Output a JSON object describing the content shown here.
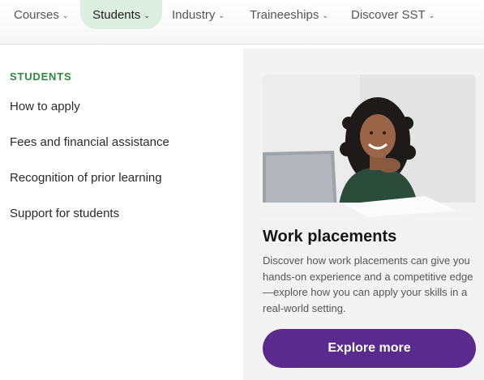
{
  "nav": {
    "items": [
      {
        "label": "Courses",
        "active": false
      },
      {
        "label": "Students",
        "active": true
      },
      {
        "label": "Industry",
        "active": false
      },
      {
        "label": "Traineeships",
        "active": false
      },
      {
        "label": "Discover SST",
        "active": false
      }
    ],
    "chevron_icon": "chevron-down-icon"
  },
  "menu": {
    "heading": "STUDENTS",
    "links": [
      "How to apply",
      "Fees and financial assistance",
      "Recognition of prior learning",
      "Support for students"
    ]
  },
  "feature": {
    "image_subject": "student-with-laptop",
    "title": "Work placements",
    "description": "Discover how work placements can give you hands-on experience and a competitive edge—explore how you can apply your skills in a real-world setting.",
    "button_label": "Explore more"
  },
  "colors": {
    "accent_green": "#2f8a3f",
    "active_nav_bg": "#dcefe0",
    "button_purple": "#5b2a8e",
    "panel_bg": "#f3f3f3"
  }
}
